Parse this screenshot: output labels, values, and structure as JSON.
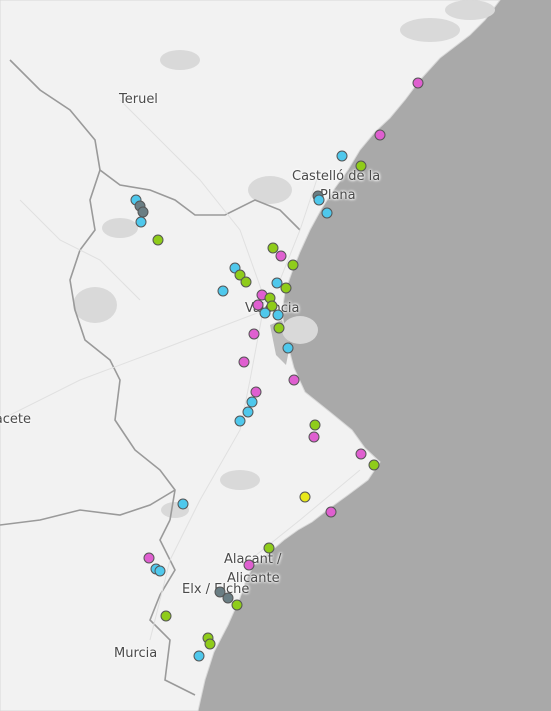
{
  "map": {
    "labels": {
      "teruel": "Teruel",
      "castello_1": "Castelló de la",
      "castello_2": "Plana",
      "valencia": "València",
      "albacete": "Albacete",
      "alicante_1": "Alacant /",
      "alicante_2": "Alicante",
      "elx": "Elx / Elche",
      "murcia": "Murcia"
    },
    "colors": {
      "sea": "#a9a9a9",
      "land": "#f2f2f2",
      "cyan": "#4fc8ec",
      "magenta": "#df5fd0",
      "green": "#8fcc1a",
      "yellow": "#e8e81a",
      "gray": "#6a7e84"
    }
  }
}
